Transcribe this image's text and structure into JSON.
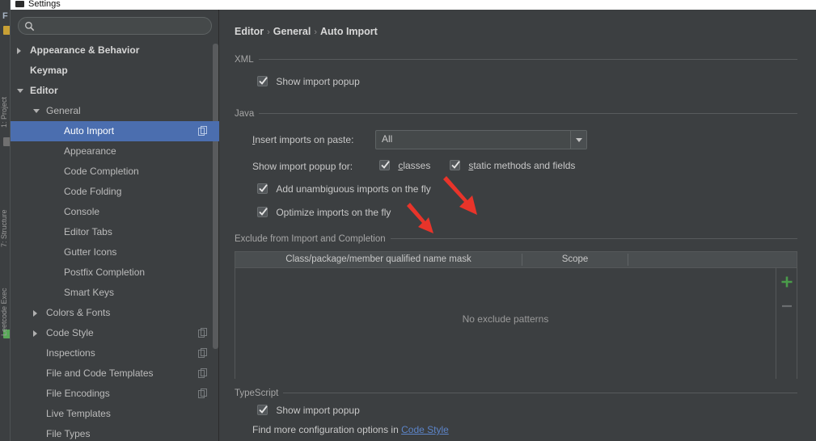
{
  "window": {
    "title": "Settings",
    "icon": "settings-window-icon"
  },
  "ide_background": {
    "menu_letter": "F",
    "tool_windows": [
      "1: Project",
      "7: Structure",
      "Leetcode Exec"
    ]
  },
  "search": {
    "value": "",
    "placeholder": "",
    "icon": "search-icon"
  },
  "sidebar": {
    "items": [
      {
        "label": "Appearance & Behavior",
        "level": 0,
        "arrow": "collapsed",
        "bold": true,
        "selected": false,
        "copy_icon": false
      },
      {
        "label": "Keymap",
        "level": 0,
        "arrow": "none",
        "bold": true,
        "selected": false,
        "copy_icon": false
      },
      {
        "label": "Editor",
        "level": 0,
        "arrow": "expanded",
        "bold": true,
        "selected": false,
        "copy_icon": false
      },
      {
        "label": "General",
        "level": 1,
        "arrow": "expanded",
        "bold": false,
        "selected": false,
        "copy_icon": false
      },
      {
        "label": "Auto Import",
        "level": 2,
        "arrow": "none",
        "bold": false,
        "selected": true,
        "copy_icon": true
      },
      {
        "label": "Appearance",
        "level": 2,
        "arrow": "none",
        "bold": false,
        "selected": false,
        "copy_icon": false
      },
      {
        "label": "Code Completion",
        "level": 2,
        "arrow": "none",
        "bold": false,
        "selected": false,
        "copy_icon": false
      },
      {
        "label": "Code Folding",
        "level": 2,
        "arrow": "none",
        "bold": false,
        "selected": false,
        "copy_icon": false
      },
      {
        "label": "Console",
        "level": 2,
        "arrow": "none",
        "bold": false,
        "selected": false,
        "copy_icon": false
      },
      {
        "label": "Editor Tabs",
        "level": 2,
        "arrow": "none",
        "bold": false,
        "selected": false,
        "copy_icon": false
      },
      {
        "label": "Gutter Icons",
        "level": 2,
        "arrow": "none",
        "bold": false,
        "selected": false,
        "copy_icon": false
      },
      {
        "label": "Postfix Completion",
        "level": 2,
        "arrow": "none",
        "bold": false,
        "selected": false,
        "copy_icon": false
      },
      {
        "label": "Smart Keys",
        "level": 2,
        "arrow": "none",
        "bold": false,
        "selected": false,
        "copy_icon": false
      },
      {
        "label": "Colors & Fonts",
        "level": 1,
        "arrow": "collapsed",
        "bold": false,
        "selected": false,
        "copy_icon": false
      },
      {
        "label": "Code Style",
        "level": 1,
        "arrow": "collapsed",
        "bold": false,
        "selected": false,
        "copy_icon": true
      },
      {
        "label": "Inspections",
        "level": 1,
        "arrow": "none",
        "bold": false,
        "selected": false,
        "copy_icon": true
      },
      {
        "label": "File and Code Templates",
        "level": 1,
        "arrow": "none",
        "bold": false,
        "selected": false,
        "copy_icon": true
      },
      {
        "label": "File Encodings",
        "level": 1,
        "arrow": "none",
        "bold": false,
        "selected": false,
        "copy_icon": true
      },
      {
        "label": "Live Templates",
        "level": 1,
        "arrow": "none",
        "bold": false,
        "selected": false,
        "copy_icon": false
      },
      {
        "label": "File Types",
        "level": 1,
        "arrow": "none",
        "bold": false,
        "selected": false,
        "copy_icon": false
      }
    ]
  },
  "breadcrumb": {
    "parts": [
      "Editor",
      "General",
      "Auto Import"
    ],
    "separator": "›"
  },
  "sections": {
    "xml": {
      "title": "XML",
      "show_import_popup": {
        "label": "Show import popup",
        "checked": true
      }
    },
    "java": {
      "title": "Java",
      "insert_imports_label": "Insert imports on paste:",
      "insert_imports_mnemonic": "I",
      "insert_imports_value": "All",
      "show_popup_label": "Show import popup for:",
      "classes": {
        "label": "classes",
        "mnemonic": "c",
        "checked": true
      },
      "static_methods": {
        "label": "static methods and fields",
        "mnemonic": "s",
        "checked": true
      },
      "add_unambiguous": {
        "label": "Add unambiguous imports on the fly",
        "checked": true
      },
      "optimize_imports": {
        "label": "Optimize imports on the fly",
        "checked": true
      }
    },
    "exclude": {
      "title": "Exclude from Import and Completion",
      "columns": [
        "Class/package/member qualified name mask",
        "Scope"
      ],
      "rows": [],
      "empty_text": "No exclude patterns",
      "add_button": "+",
      "remove_button": "−"
    },
    "typescript": {
      "title": "TypeScript",
      "show_import_popup": {
        "label": "Show import popup",
        "checked": true
      },
      "hint_prefix": "Find more configuration options in ",
      "hint_link": "Code Style"
    }
  },
  "annotations": {
    "arrow_color": "#e8342a",
    "count": 2
  },
  "colors": {
    "background": "#3c3f41",
    "selection": "#4b6eaf",
    "text": "#bbbbbb",
    "link": "#5c84c8",
    "accent_green": "#4a9c4a"
  }
}
